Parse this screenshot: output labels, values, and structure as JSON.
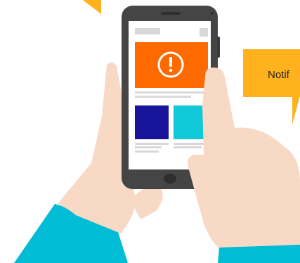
{
  "notification_label": "Notif",
  "phone_screen": {
    "alert_icon": "exclamation-circle-icon"
  },
  "colors": {
    "alert_banner": "#FF6A00",
    "tile_navy": "#18149A",
    "tile_cyan": "#0FC8D8",
    "callout_yellow": "#FFB21E",
    "sleeve_teal": "#00BCD4",
    "skin": "#F8D9C5",
    "phone_body": "#454545",
    "placeholder_gray": "#D8D8D8",
    "text_dark": "#222222"
  }
}
